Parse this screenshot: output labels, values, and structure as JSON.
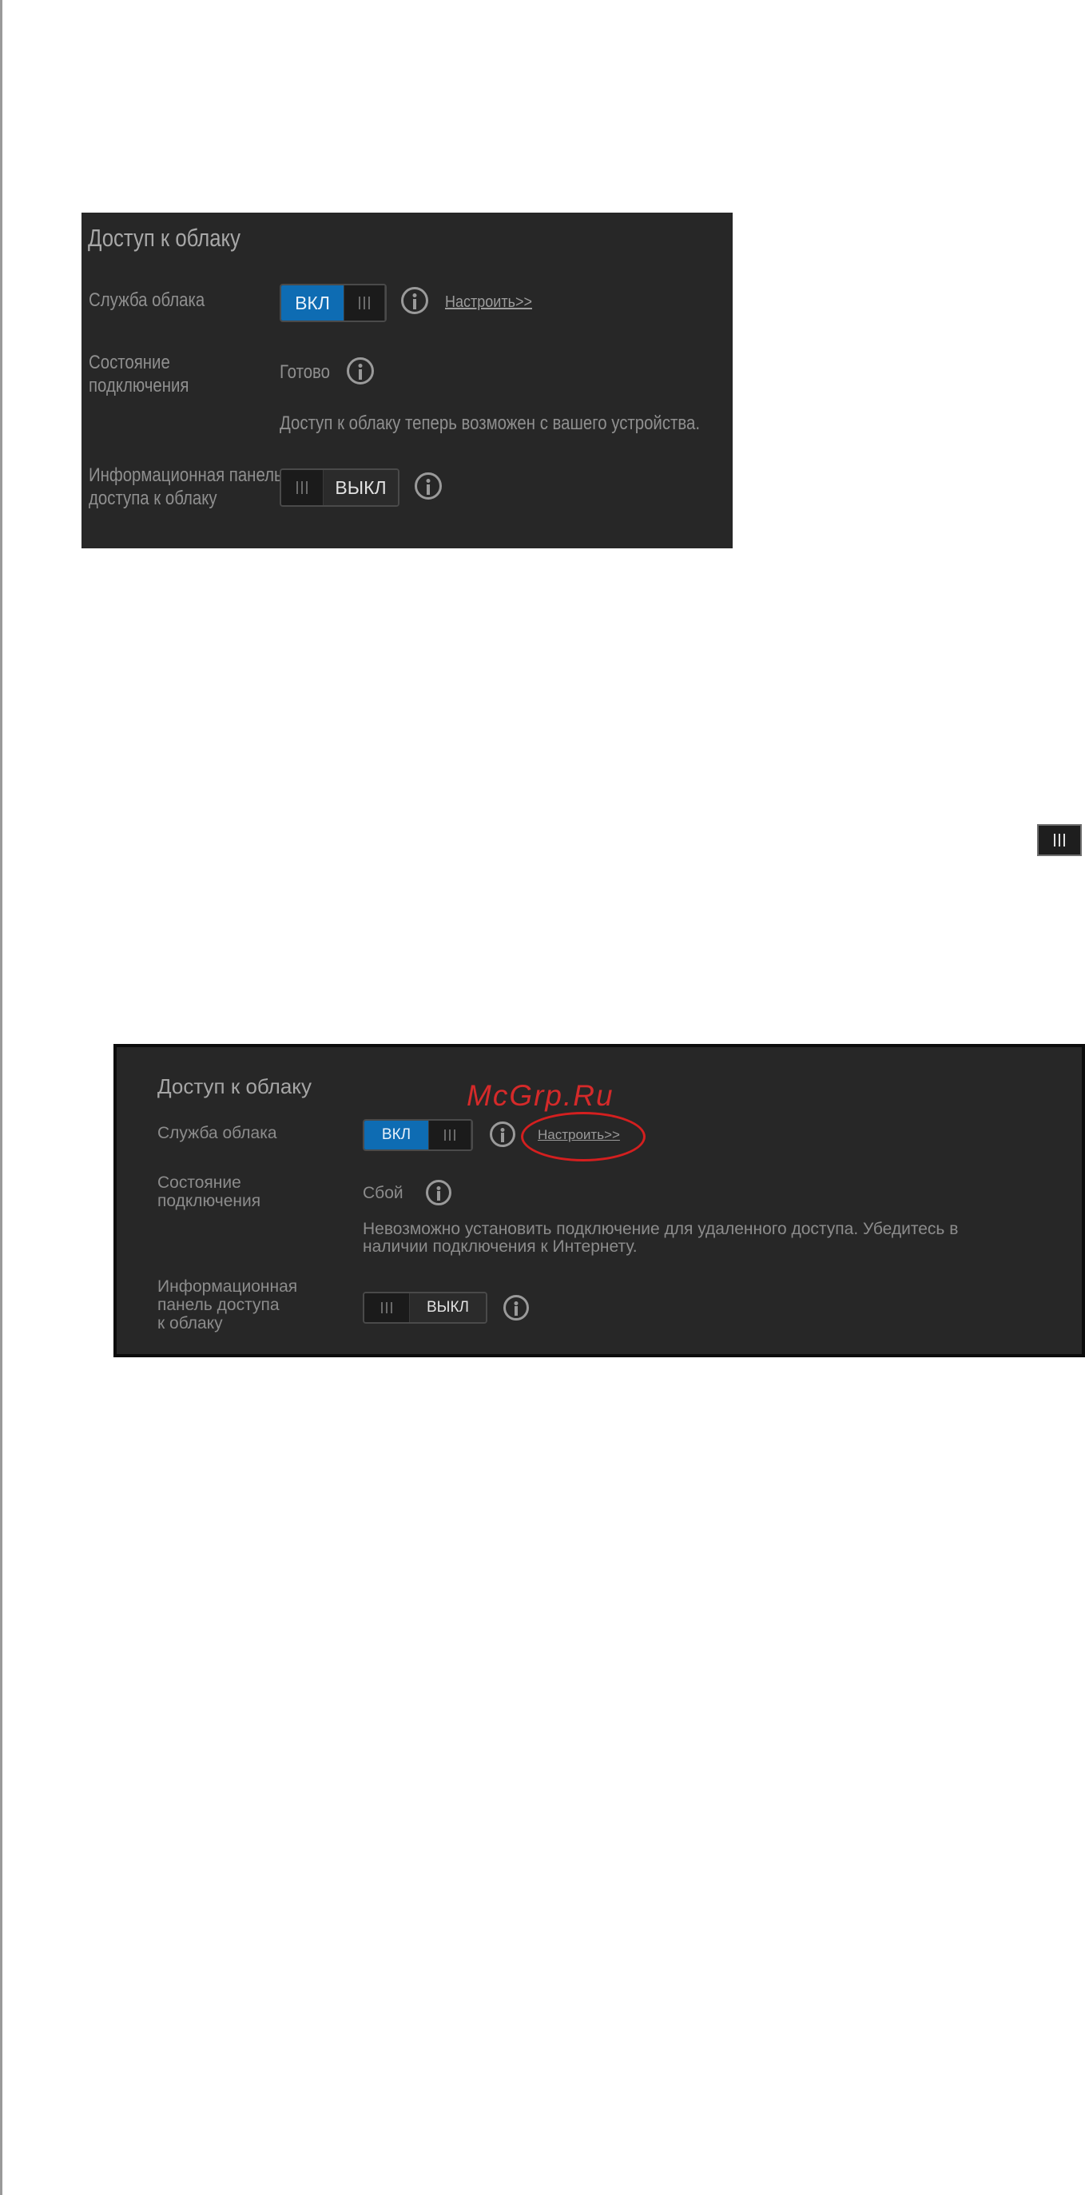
{
  "panel_on": {
    "title": "Доступ к облаку",
    "cloud_service_label": "Служба облака",
    "cloud_service_toggle": "ВКЛ",
    "configure_link": "Настроить>>",
    "status_label_line1": "Состояние",
    "status_label_line2": "подключения",
    "status_value": "Готово",
    "status_message": "Доступ к облаку теперь возможен с вашего устройства.",
    "dashboard_label_line1": "Информационная панель",
    "dashboard_label_line2": "доступа к облаку",
    "dashboard_toggle": "ВЫКЛ"
  },
  "panel_fail": {
    "title": "Доступ к облаку",
    "cloud_service_label": "Служба облака",
    "cloud_service_toggle": "ВКЛ",
    "configure_link": "Настроить>>",
    "status_label_line1": "Состояние",
    "status_label_line2": "подключения",
    "status_value": "Сбой",
    "status_message_line1": "Невозможно установить подключение для удаленного доступа. Убедитесь в",
    "status_message_line2": "наличии подключения к Интернету.",
    "dashboard_label_line1": "Информационная",
    "dashboard_label_line2": "панель доступа",
    "dashboard_label_line3": "к облаку",
    "dashboard_toggle": "ВЫКЛ"
  },
  "watermark": "McGrp.Ru",
  "colors": {
    "panel_bg": "#272727",
    "toggle_on": "#0e6cb3",
    "highlight": "#d41f1f"
  },
  "icons": [
    "info-icon",
    "grip-icon"
  ]
}
